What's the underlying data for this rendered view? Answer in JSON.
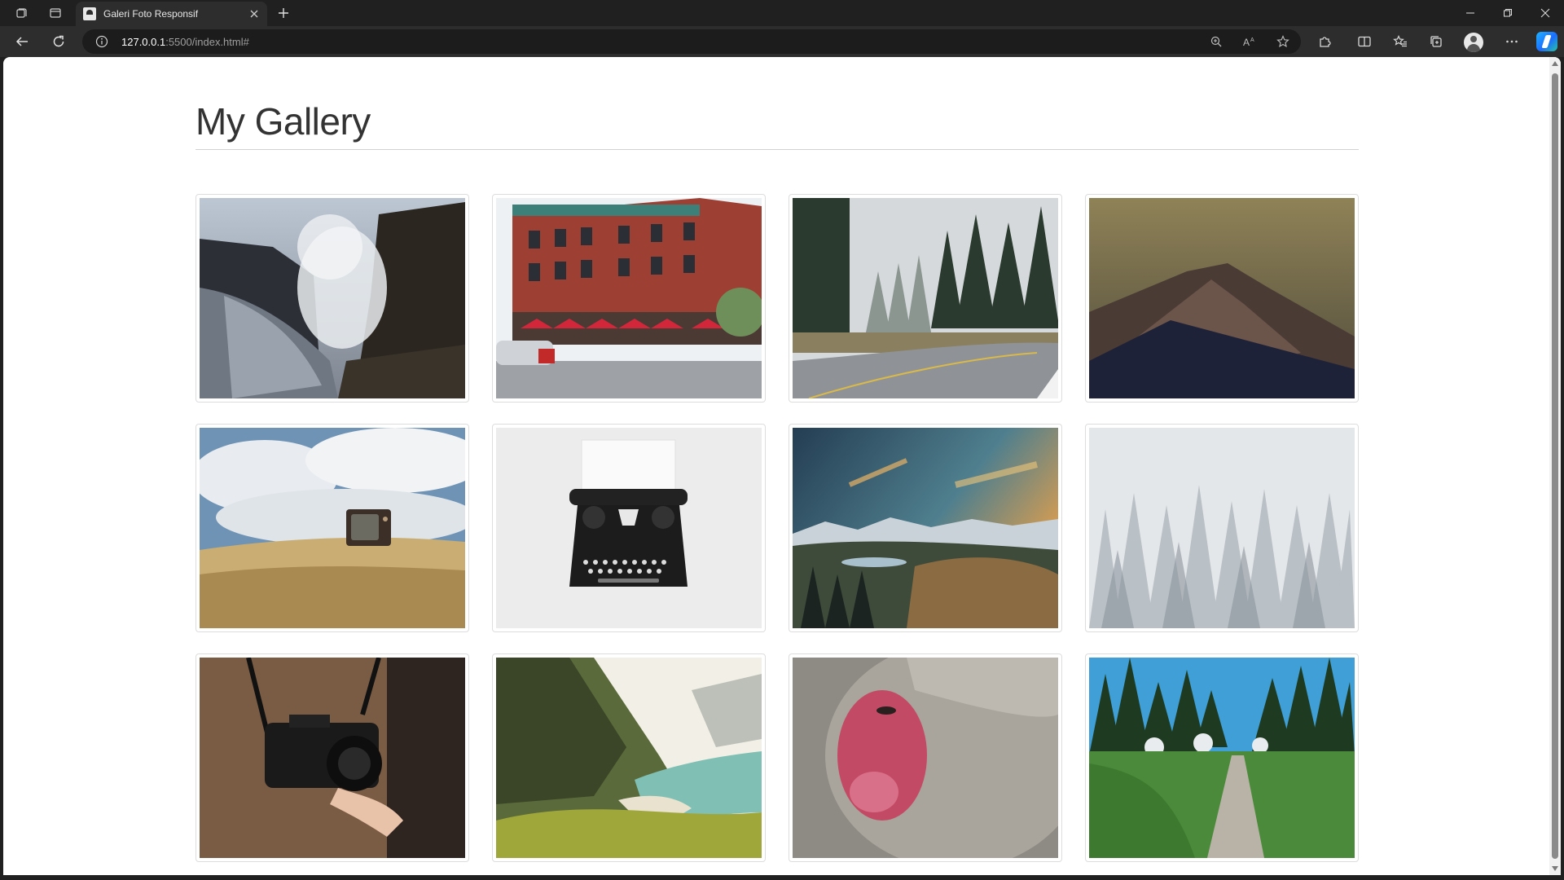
{
  "browser": {
    "tab": {
      "title": "Galeri Foto Responsif",
      "favicon": "page-icon"
    },
    "address": {
      "host": "127.0.0.1",
      "rest": ":5500/index.html#"
    },
    "icons": [
      "workspaces-icon",
      "tab-actions-icon",
      "close-icon",
      "plus-icon",
      "minimize-icon",
      "restore-icon",
      "back-icon",
      "refresh-icon",
      "info-icon",
      "zoom-icon",
      "read-aloud-icon",
      "favorite-star-icon",
      "extensions-icon",
      "split-screen-icon",
      "favorites-icon",
      "collections-icon",
      "profile-icon",
      "more-icon",
      "copilot-icon"
    ]
  },
  "page": {
    "title": "My Gallery"
  },
  "gallery": {
    "images": [
      {
        "subject": "waterfall-mist"
      },
      {
        "subject": "brick-building-cafe"
      },
      {
        "subject": "foggy-forest-road"
      },
      {
        "subject": "dark-mountain-peak"
      },
      {
        "subject": "vintage-tv-on-sand"
      },
      {
        "subject": "typewriter"
      },
      {
        "subject": "mountain-valley-sunset"
      },
      {
        "subject": "snowy-forest"
      },
      {
        "subject": "person-with-camera"
      },
      {
        "subject": "coastal-valley-beach"
      },
      {
        "subject": "snow-monkey-face"
      },
      {
        "subject": "park-path-trees"
      }
    ]
  },
  "colors": {
    "chrome_dark": "#202020",
    "toolbar": "#2d2d2d",
    "page_bg": "#ffffff",
    "title_text": "#333333",
    "thumb_border": "#dddddd"
  }
}
